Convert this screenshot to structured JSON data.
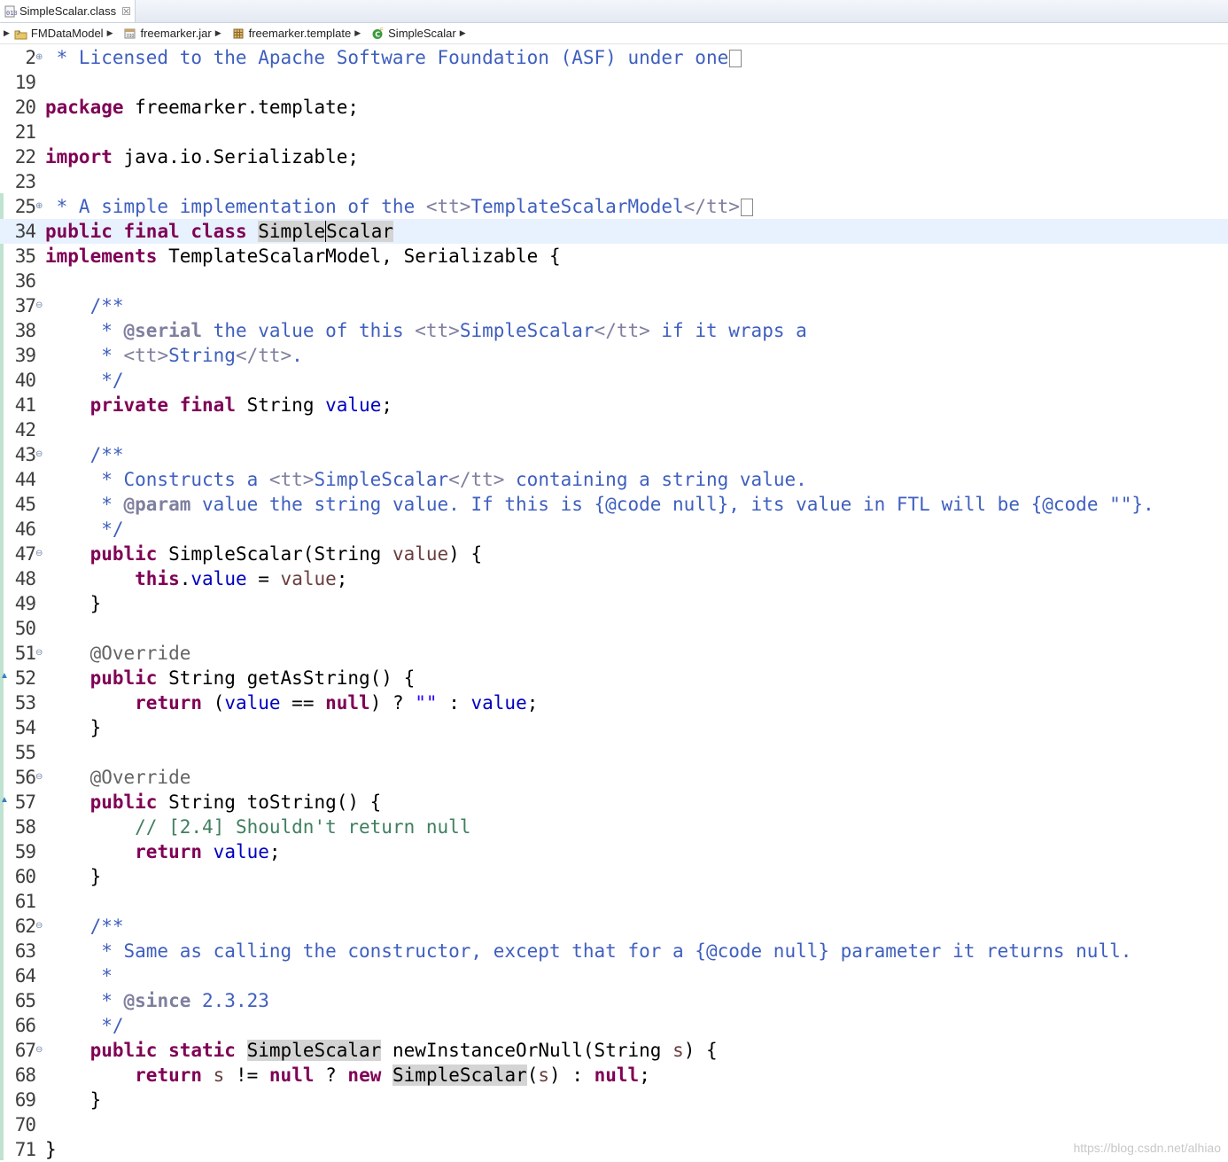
{
  "tab": {
    "title": "SimpleScalar.class",
    "close_glyph": "☒"
  },
  "breadcrumbs": [
    {
      "label": "FMDataModel",
      "icon": "project-icon"
    },
    {
      "label": "freemarker.jar",
      "icon": "jar-icon"
    },
    {
      "label": "freemarker.template",
      "icon": "package-icon"
    },
    {
      "label": "SimpleScalar",
      "icon": "class-icon"
    }
  ],
  "editor": {
    "lines": [
      {
        "n": "2",
        "fold": "⊕",
        "html": "<span class=\"jd\"> * Licensed to the Apache Software Foundation (ASF) under one</span><span class=\"box\"></span>"
      },
      {
        "n": "19",
        "html": ""
      },
      {
        "n": "20",
        "html": "<span class=\"kw\">package</span> freemarker.template;"
      },
      {
        "n": "21",
        "html": ""
      },
      {
        "n": "22",
        "html": "<span class=\"kw\">import</span> java.io.Serializable;"
      },
      {
        "n": "23",
        "html": ""
      },
      {
        "n": "25",
        "fold": "⊕",
        "html": "<span class=\"jd\"> * A simple implementation of the <span class=\"ht\">&lt;tt&gt;</span>TemplateScalarModel<span class=\"ht\">&lt;/tt&gt;</span></span><span class=\"box\"></span>"
      },
      {
        "n": "34",
        "cur": true,
        "html": "<span class=\"kw\">public</span> <span class=\"kw\">final</span> <span class=\"kw\">class</span> <span class=\"occ\">Simple<span style=\"border-left:1px solid #000;\"></span>Scalar</span>"
      },
      {
        "n": "35",
        "html": "<span class=\"kw\">implements</span> TemplateScalarModel, Serializable {"
      },
      {
        "n": "36",
        "html": ""
      },
      {
        "n": "37",
        "fold": "⊖",
        "html": "    <span class=\"jd\">/**</span>"
      },
      {
        "n": "38",
        "html": "<span class=\"jd\">     * <span class=\"jt\">@serial</span> the value of this <span class=\"ht\">&lt;tt&gt;</span>SimpleScalar<span class=\"ht\">&lt;/tt&gt;</span> if it wraps a</span>"
      },
      {
        "n": "39",
        "html": "<span class=\"jd\">     * <span class=\"ht\">&lt;tt&gt;</span>String<span class=\"ht\">&lt;/tt&gt;</span>.</span>"
      },
      {
        "n": "40",
        "html": "<span class=\"jd\">     */</span>"
      },
      {
        "n": "41",
        "html": "    <span class=\"kw\">private</span> <span class=\"kw\">final</span> String <span class=\"fd\">value</span>;"
      },
      {
        "n": "42",
        "html": ""
      },
      {
        "n": "43",
        "fold": "⊖",
        "html": "    <span class=\"jd\">/**</span>"
      },
      {
        "n": "44",
        "html": "<span class=\"jd\">     * Constructs a <span class=\"ht\">&lt;tt&gt;</span>SimpleScalar<span class=\"ht\">&lt;/tt&gt;</span> containing a string value.</span>"
      },
      {
        "n": "45",
        "html": "<span class=\"jd\">     * <span class=\"jt\">@param</span> value the string value. If this is {@code null}, its value in FTL will be {@code \"\"}.</span>"
      },
      {
        "n": "46",
        "html": "<span class=\"jd\">     */</span>"
      },
      {
        "n": "47",
        "fold": "⊖",
        "html": "    <span class=\"kw\">public</span> SimpleScalar(String <span class=\"pa\">value</span>) {"
      },
      {
        "n": "48",
        "html": "        <span class=\"kw\">this</span>.<span class=\"fd\">value</span> = <span class=\"pa\">value</span>;"
      },
      {
        "n": "49",
        "html": "    }"
      },
      {
        "n": "50",
        "html": ""
      },
      {
        "n": "51",
        "fold": "⊖",
        "html": "    <span class=\"an\">@Override</span>"
      },
      {
        "n": "52",
        "html": "    <span class=\"kw\">public</span> String getAsString() {"
      },
      {
        "n": "53",
        "html": "        <span class=\"kw\">return</span> (<span class=\"fd\">value</span> == <span class=\"kw\">null</span>) ? <span class=\"st\">\"\"</span> : <span class=\"fd\">value</span>;"
      },
      {
        "n": "54",
        "html": "    }"
      },
      {
        "n": "55",
        "html": ""
      },
      {
        "n": "56",
        "fold": "⊖",
        "html": "    <span class=\"an\">@Override</span>"
      },
      {
        "n": "57",
        "html": "    <span class=\"kw\">public</span> String toString() {"
      },
      {
        "n": "58",
        "html": "        <span class=\"cm\">// [2.4] Shouldn't return null</span>"
      },
      {
        "n": "59",
        "html": "        <span class=\"kw\">return</span> <span class=\"fd\">value</span>;"
      },
      {
        "n": "60",
        "html": "    }"
      },
      {
        "n": "61",
        "html": ""
      },
      {
        "n": "62",
        "fold": "⊖",
        "html": "    <span class=\"jd\">/**</span>"
      },
      {
        "n": "63",
        "html": "<span class=\"jd\">     * Same as calling the constructor, except that for a {@code null} parameter it returns null.</span>"
      },
      {
        "n": "64",
        "html": "<span class=\"jd\">     *</span>"
      },
      {
        "n": "65",
        "html": "<span class=\"jd\">     * <span class=\"jt\">@since</span> 2.3.23</span>"
      },
      {
        "n": "66",
        "html": "<span class=\"jd\">     */</span>"
      },
      {
        "n": "67",
        "fold": "⊖",
        "html": "    <span class=\"kw\">public</span> <span class=\"kw\">static</span> <span class=\"occ\">SimpleScalar</span> newInstanceOrNull(String <span class=\"pa\">s</span>) {"
      },
      {
        "n": "68",
        "html": "        <span class=\"kw\">return</span> <span class=\"pa\">s</span> != <span class=\"kw\">null</span> ? <span class=\"kw\">new</span> <span class=\"occ\">SimpleScalar</span>(<span class=\"pa\">s</span>) : <span class=\"kw\">null</span>;"
      },
      {
        "n": "69",
        "html": "    }"
      },
      {
        "n": "70",
        "html": ""
      },
      {
        "n": "71",
        "html": "}"
      }
    ]
  },
  "watermark": "https://blog.csdn.net/alhiao"
}
